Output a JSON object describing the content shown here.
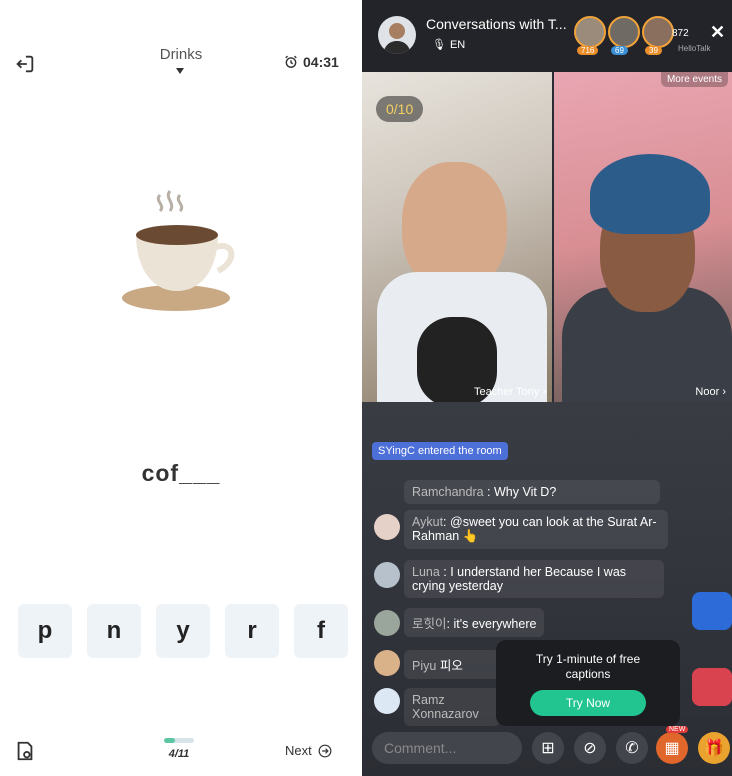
{
  "quiz": {
    "category": "Drinks",
    "timer": "04:31",
    "word": "cof___",
    "letters": [
      "p",
      "n",
      "y",
      "r",
      "f"
    ],
    "progress_text": "4/11",
    "progress_fraction": 0.36,
    "next_label": "Next",
    "accent": "#5ac6a2"
  },
  "room": {
    "title": "Conversations with T...",
    "language": "EN",
    "viewer_badges": [
      "716",
      "69",
      "39"
    ],
    "viewer_count": "872",
    "close_label": "✕",
    "brand": "HelloTalk",
    "counter": "0/10",
    "more_events": "More events",
    "speaker1": "Teacher Tony",
    "speaker2": "Noor",
    "entered": "SYingC entered the room",
    "messages": [
      {
        "name": "Ramchandra",
        "text": "Why Vit D?"
      },
      {
        "name": "Aykut",
        "text": "@sweet you can look at the Surat Ar-Rahman 👆"
      },
      {
        "name": "Luna",
        "text": "I understand her Because I was crying yesterday"
      },
      {
        "name": "로힛이",
        "text": "it's everywhere"
      },
      {
        "name": "Piyu",
        "text": "피오"
      },
      {
        "name": "Ramz Xonnazarov",
        "text": ""
      }
    ],
    "tooltip_text": "Try 1-minute of free captions",
    "try_now": "Try Now",
    "comment_placeholder": "Comment...",
    "new_badge": "NEW"
  }
}
